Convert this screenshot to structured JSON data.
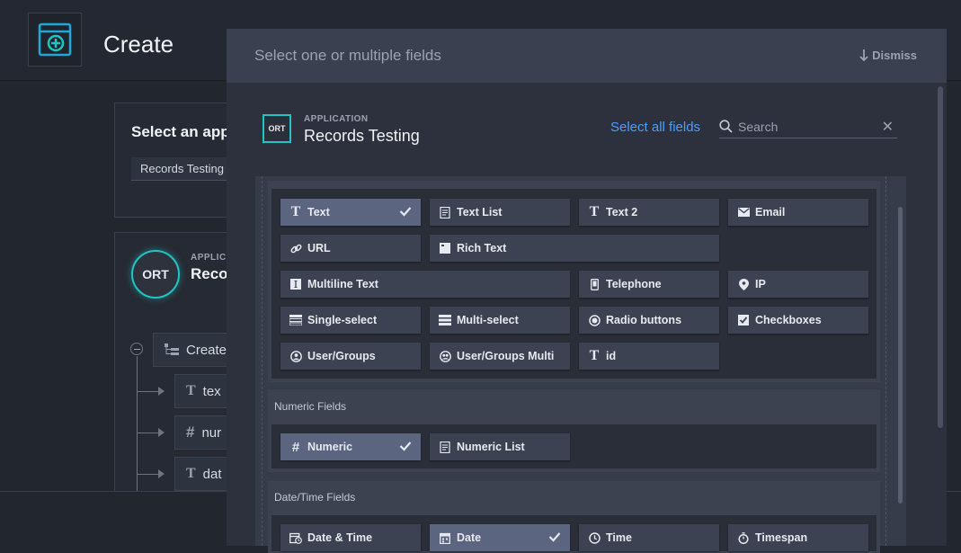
{
  "page": {
    "title": "Create"
  },
  "background": {
    "select_app_label": "Select an app",
    "select_app_value": "Records Testing",
    "ort_badge": "ORT",
    "app_label": "APPLICA",
    "app_name": "Recor",
    "tree": [
      {
        "label": "Create"
      },
      {
        "label": "tex"
      },
      {
        "label": "nur"
      },
      {
        "label": "dat"
      }
    ]
  },
  "modal": {
    "header_placeholder": "Select one or multiple fields",
    "dismiss_label": "Dismiss",
    "app_badge": "ORT",
    "app_label": "APPLICATION",
    "app_name": "Records Testing",
    "select_all_label": "Select all fields",
    "search_placeholder": "Search"
  },
  "fields": {
    "text_section": [
      {
        "label": "Text",
        "icon": "text-t-icon",
        "selected": true
      },
      {
        "label": "Text List",
        "icon": "text-list-icon",
        "selected": false
      },
      {
        "label": "Text 2",
        "icon": "text-t-icon",
        "selected": false
      },
      {
        "label": "Email",
        "icon": "email-icon",
        "selected": false
      },
      {
        "label": "URL",
        "icon": "link-icon",
        "selected": false
      },
      {
        "label": "Rich Text",
        "icon": "rich-text-icon",
        "selected": false
      },
      {
        "label": "Multiline Text",
        "icon": "multiline-icon",
        "selected": false
      },
      {
        "label": "Telephone",
        "icon": "phone-icon",
        "selected": false
      },
      {
        "label": "IP",
        "icon": "ip-icon",
        "selected": false
      },
      {
        "label": "Single-select",
        "icon": "single-select-icon",
        "selected": false
      },
      {
        "label": "Multi-select",
        "icon": "multi-select-icon",
        "selected": false
      },
      {
        "label": "Radio buttons",
        "icon": "radio-icon",
        "selected": false
      },
      {
        "label": "Checkboxes",
        "icon": "checkbox-icon",
        "selected": false
      },
      {
        "label": "User/Groups",
        "icon": "user-icon",
        "selected": false
      },
      {
        "label": "User/Groups Multi",
        "icon": "users-icon",
        "selected": false
      },
      {
        "label": "id",
        "icon": "text-t-icon",
        "selected": false
      }
    ],
    "numeric_section": {
      "title": "Numeric Fields",
      "items": [
        {
          "label": "Numeric",
          "icon": "hash-icon",
          "selected": true
        },
        {
          "label": "Numeric List",
          "icon": "numeric-list-icon",
          "selected": false
        }
      ]
    },
    "datetime_section": {
      "title": "Date/Time Fields",
      "items": [
        {
          "label": "Date & Time",
          "icon": "calendar-clock-icon",
          "selected": false
        },
        {
          "label": "Date",
          "icon": "calendar-icon",
          "selected": true
        },
        {
          "label": "Time",
          "icon": "clock-icon",
          "selected": false
        },
        {
          "label": "Timespan",
          "icon": "stopwatch-icon",
          "selected": false
        }
      ]
    }
  },
  "colors": {
    "accent": "#1fc4c4",
    "link": "#4a9eff",
    "selected_chip": "#5c6580"
  }
}
